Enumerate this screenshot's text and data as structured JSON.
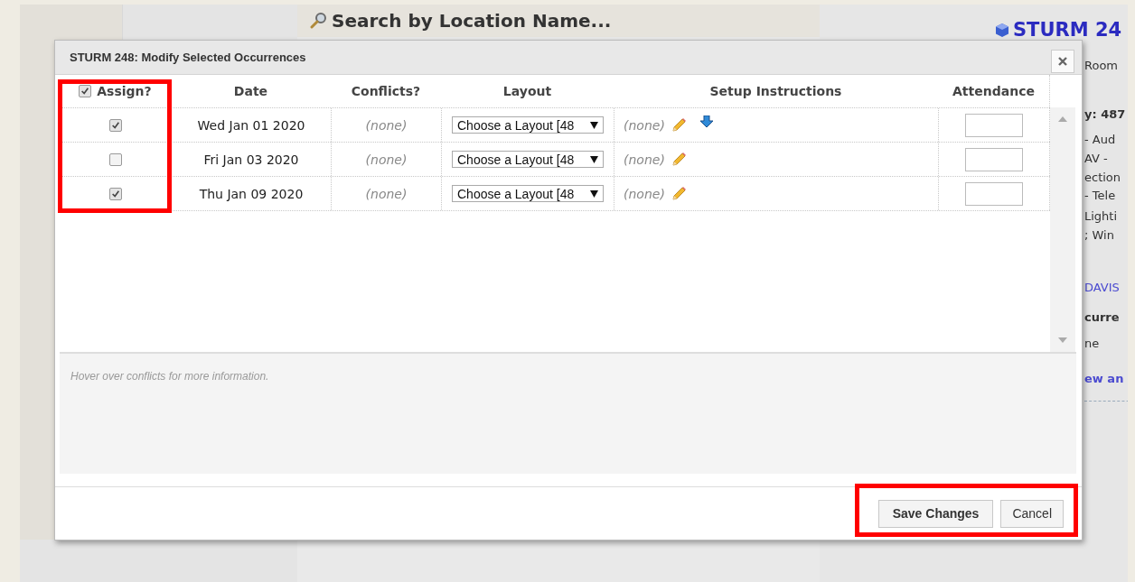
{
  "background": {
    "search_title": "Search by Location Name...",
    "room_title": "STURM 24",
    "room_lines": [
      {
        "text": "Room",
        "kind": "plain"
      },
      {
        "text": "y: 487",
        "kind": "bold"
      },
      {
        "text": "- Aud",
        "kind": "plain"
      },
      {
        "text": "AV -",
        "kind": "plain"
      },
      {
        "text": "ection",
        "kind": "plain"
      },
      {
        "text": "- Tele",
        "kind": "plain"
      },
      {
        "text": "Lighti",
        "kind": "plain"
      },
      {
        "text": "; Win",
        "kind": "plain"
      },
      {
        "text": "DAVIS",
        "kind": "link"
      },
      {
        "text": "curre",
        "kind": "bold"
      },
      {
        "text": "ne",
        "kind": "plain"
      },
      {
        "text": "ew an",
        "kind": "boldlink"
      }
    ]
  },
  "modal": {
    "title": "STURM 248: Modify Selected Occurrences",
    "assign_all": {
      "checked": true
    },
    "columns": [
      "Assign?",
      "Date",
      "Conflicts?",
      "Layout",
      "Setup Instructions",
      "Attendance"
    ],
    "rows": [
      {
        "assign": true,
        "date": "Wed Jan 01 2020",
        "conflicts": "(none)",
        "layout": "Choose a Layout [48",
        "setup": "(none)",
        "move_down": true,
        "attendance": ""
      },
      {
        "assign": false,
        "date": "Fri Jan 03 2020",
        "conflicts": "(none)",
        "layout": "Choose a Layout [48",
        "setup": "(none)",
        "move_down": false,
        "attendance": ""
      },
      {
        "assign": true,
        "date": "Thu Jan 09 2020",
        "conflicts": "(none)",
        "layout": "Choose a Layout [48",
        "setup": "(none)",
        "move_down": false,
        "attendance": ""
      }
    ],
    "info": "Hover over conflicts for more information.",
    "buttons": [
      "Save Changes",
      "Cancel"
    ]
  }
}
